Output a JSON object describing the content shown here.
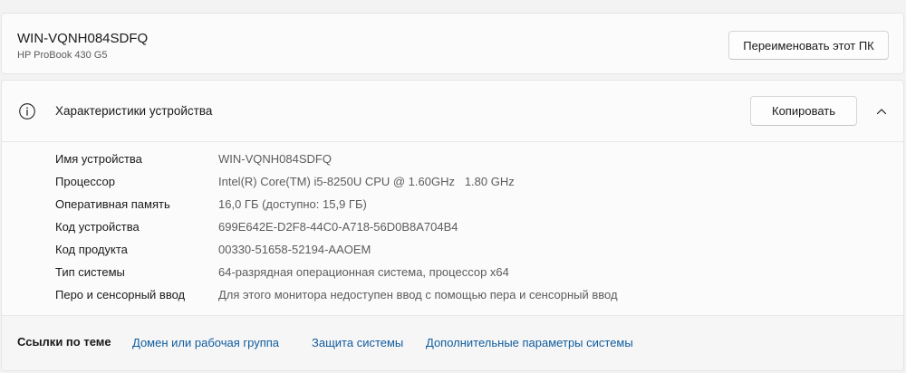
{
  "device": {
    "name": "WIN-VQNH084SDFQ",
    "model": "HP ProBook 430 G5",
    "rename_button": "Переименовать этот ПК"
  },
  "specs": {
    "title": "Характеристики устройства",
    "copy_button": "Копировать",
    "icons": {
      "info": "info-icon",
      "collapse": "chevron-up-icon"
    },
    "rows": [
      {
        "label": "Имя устройства",
        "value": "WIN-VQNH084SDFQ"
      },
      {
        "label": "Процессор",
        "value": "Intel(R) Core(TM) i5-8250U CPU @ 1.60GHz   1.80 GHz"
      },
      {
        "label": "Оперативная память",
        "value": "16,0 ГБ (доступно: 15,9 ГБ)"
      },
      {
        "label": "Код устройства",
        "value": "699E642E-D2F8-44C0-A718-56D0B8A704B4"
      },
      {
        "label": "Код продукта",
        "value": "00330-51658-52194-AAOEM"
      },
      {
        "label": "Тип системы",
        "value": "64-разрядная операционная система, процессор x64"
      },
      {
        "label": "Перо и сенсорный ввод",
        "value": "Для этого монитора недоступен ввод с помощью пера и сенсорный ввод"
      }
    ]
  },
  "related": {
    "title": "Ссылки по теме",
    "links": [
      "Домен или рабочая группа",
      "Защита системы",
      "Дополнительные параметры системы"
    ]
  },
  "colors": {
    "link": "#0f5c9e",
    "background": "#f3f3f3",
    "card": "#fbfbfb"
  }
}
